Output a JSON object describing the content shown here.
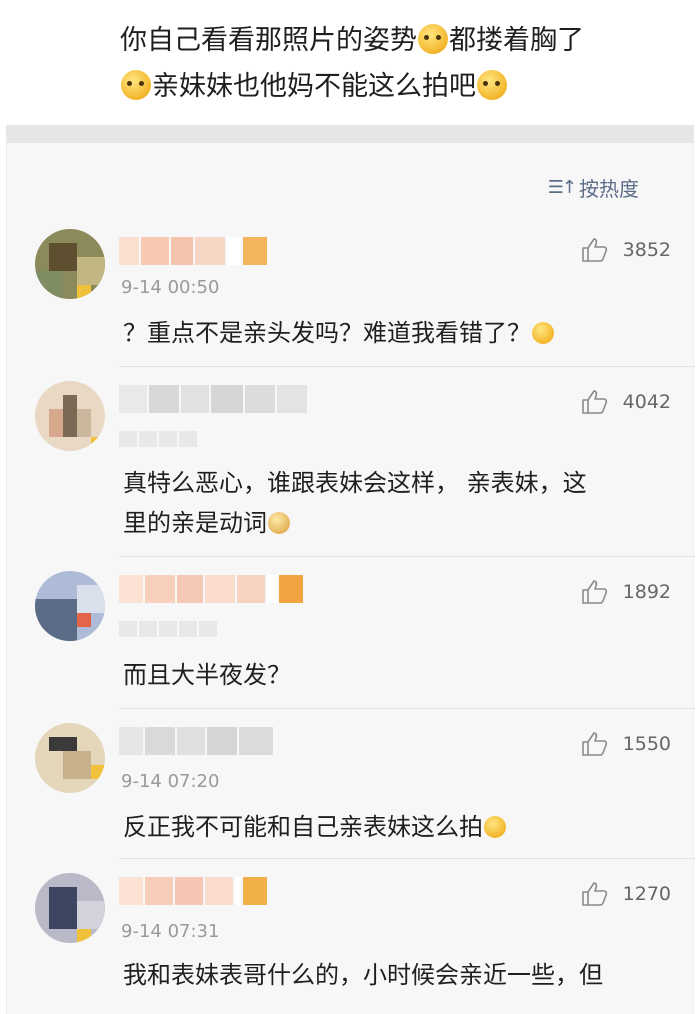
{
  "post": {
    "line1": "你自己看看那照片的姿势",
    "line1b": "都搂着胸了",
    "line2": "亲妹妹也他妈不能这么拍吧"
  },
  "sort": {
    "label": "按热度",
    "icon": "sort-order-icon"
  },
  "comments": [
    {
      "likes": "3852",
      "time": "9-14 00:50",
      "text": "？重点不是亲头发吗？难道我看错了？"
    },
    {
      "likes": "4042",
      "time": "",
      "text_l1": "真特么恶心，谁跟表妹会这样， 亲表妹，这",
      "text_l2": "里的亲是动词"
    },
    {
      "likes": "1892",
      "time": "",
      "text": "而且大半夜发？"
    },
    {
      "likes": "1550",
      "time": "9-14 07:20",
      "text": "反正我不可能和自己亲表妹这么拍"
    },
    {
      "likes": "1270",
      "time": "9-14 07:31",
      "text": "我和表妹表哥什么的，小时候会亲近一些，但"
    }
  ],
  "colors": {
    "sort_accent": "#5b6d88",
    "like_text": "#666666",
    "time_text": "#9a9a9a"
  }
}
